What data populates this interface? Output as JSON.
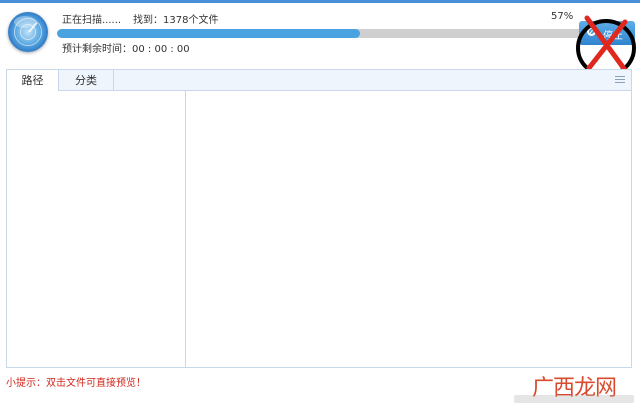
{
  "scan": {
    "status_text": "正在扫描......",
    "found_text": "找到：1378个文件",
    "percent_text": "57%",
    "progress": 0.57,
    "eta_text": "预计剩余时间：00 : 00 : 00",
    "stop_label": "停止"
  },
  "tabs": [
    {
      "label": "路径",
      "active": true
    },
    {
      "label": "分类",
      "active": false
    }
  ],
  "tip_text": "小提示：双击文件可直接预览！",
  "watermark_text": "广西龙网",
  "icons": {
    "radar": "radar-scan-icon",
    "stop": "stop-icon",
    "menu": "menu-icon",
    "annotation": "red-x-annotation-icon"
  },
  "colors": {
    "accent": "#4aa3e0",
    "tip": "#d0271c",
    "watermark": "#d94a2f"
  }
}
